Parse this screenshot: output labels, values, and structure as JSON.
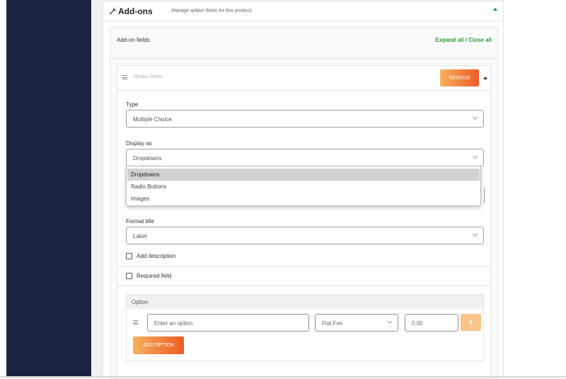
{
  "colors": {
    "sidebar": "#1b2340",
    "accent_gradient_start": "#f6b15f",
    "accent_gradient_end": "#ef5a24",
    "link_green": "#2a9d3a"
  },
  "panel": {
    "icon": "wrench-icon",
    "title": "Add-ons",
    "description": "Manage addon fields for this product."
  },
  "fields": {
    "label": "Add-on fields",
    "expand_link": "Expand all / Close all"
  },
  "addon": {
    "name": "Multiple Choice",
    "remove_label": "REMOVE",
    "type_label": "Type",
    "type_value": "Multiple Choice",
    "display_label": "Display as",
    "display_value": "Dropdowns",
    "display_options": [
      "Dropdowns",
      "Radio Buttons",
      "Images"
    ],
    "format_label": "Format title",
    "format_value": "Label",
    "add_description_label": "Add description",
    "required_label": "Required field"
  },
  "option": {
    "title": "Option",
    "input_placeholder": "Enter an option",
    "price_type": "Flat Fee",
    "price_value": "0.00",
    "remove_label": "X",
    "add_label": "ADD OPTION"
  }
}
